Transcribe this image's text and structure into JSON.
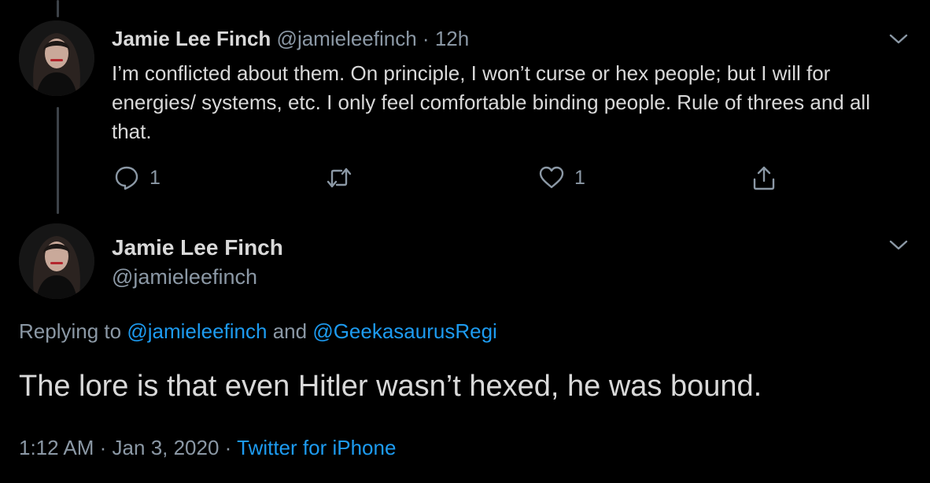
{
  "colors": {
    "background": "#000000",
    "primary_text": "#d9d9d9",
    "secondary_text": "#8b98a5",
    "link": "#1d9bf0",
    "thread_line": "#3d4248"
  },
  "icons": {
    "reply": "speech-bubble-icon",
    "retweet": "retweet-icon",
    "like": "heart-icon",
    "share": "share-icon",
    "more": "chevron-down-icon"
  },
  "parent_tweet": {
    "author_name": "Jamie Lee Finch",
    "handle": "@jamieleefinch",
    "separator": "·",
    "time": "12h",
    "text": "I’m conflicted about them. On principle, I won’t curse or hex people; but I will for energies/ systems, etc. I only feel comfortable binding people. Rule of threes and all that.",
    "reply_count": "1",
    "like_count": "1"
  },
  "main_tweet": {
    "author_name": "Jamie Lee Finch",
    "handle": "@jamieleefinch",
    "replying_prefix": "Replying to",
    "replying_to": [
      "@jamieleefinch",
      "@GeekasaurusRegi"
    ],
    "replying_joiner": "and",
    "text": "The lore is that even Hitler wasn’t hexed, he was bound.",
    "time": "1:12 AM",
    "separator": "·",
    "date": "Jan 3, 2020",
    "source": "Twitter for iPhone"
  }
}
